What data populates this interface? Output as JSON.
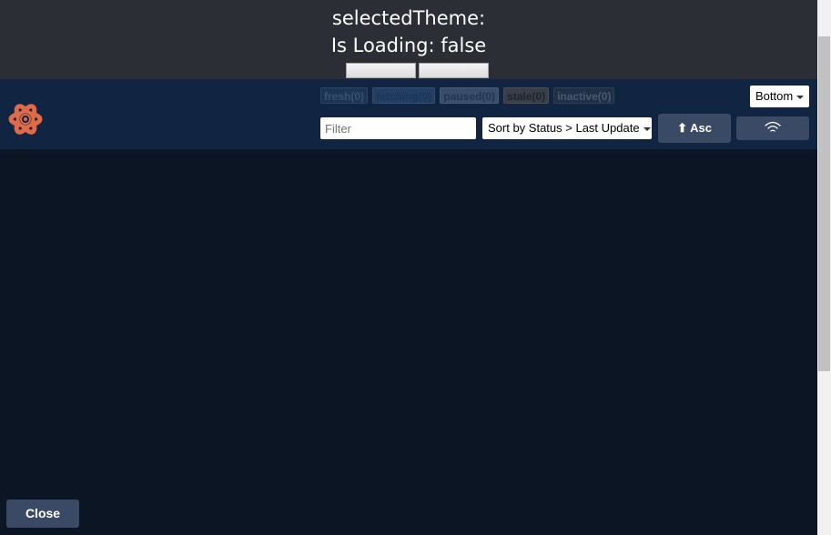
{
  "app_header": {
    "selected_theme_text": "selectedTheme:",
    "loading_text": "Is Loading: false"
  },
  "devtools": {
    "status_badges": [
      {
        "label": "fresh",
        "count": "(0)"
      },
      {
        "label": "fetching",
        "count": "(0)"
      },
      {
        "label": "paused",
        "count": "(0)"
      },
      {
        "label": "stale",
        "count": "(0)"
      },
      {
        "label": "inactive",
        "count": "(0)"
      }
    ],
    "position_select": {
      "value": "Bottom"
    },
    "filter": {
      "placeholder": "Filter",
      "value": ""
    },
    "sort_select": {
      "value": "Sort by Status > Last Update"
    },
    "sort_direction": {
      "label": "⬆ Asc"
    },
    "online_toggle": {
      "icon": "wifi-icon"
    },
    "logo": {
      "icon": "react-query-logo-icon",
      "color": "#e06b46"
    },
    "close_button": {
      "label": "Close"
    }
  },
  "colors": {
    "app_header_bg": "#2b2e35",
    "panel_header_bg": "#112542",
    "panel_bg": "#0b1523",
    "button_bg": "#3b4a64"
  }
}
